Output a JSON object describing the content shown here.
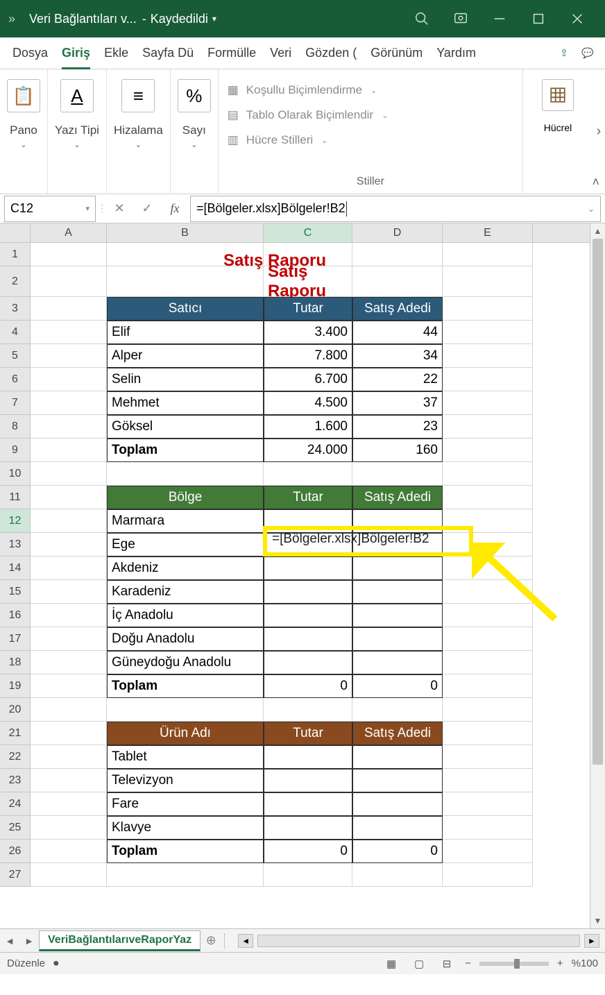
{
  "titlebar": {
    "title": "Veri Bağlantıları v...",
    "saved": "Kaydedildi"
  },
  "tabs": {
    "file": "Dosya",
    "home": "Giriş",
    "insert": "Ekle",
    "page": "Sayfa Dü",
    "formulas": "Formülle",
    "data": "Veri",
    "review": "Gözden (",
    "view": "Görünüm",
    "help": "Yardım"
  },
  "ribbon": {
    "clipboard": "Pano",
    "font": "Yazı Tipi",
    "alignment": "Hizalama",
    "number": "Sayı",
    "cond_format": "Koşullu Biçimlendirme",
    "format_table": "Tablo Olarak Biçimlendir",
    "cell_styles": "Hücre Stilleri",
    "styles_label": "Stiller",
    "cells": "Hücrel"
  },
  "namebox": "C12",
  "formula": "=[Bölgeler.xlsx]Bölgeler!B2",
  "columns": [
    "A",
    "B",
    "C",
    "D",
    "E"
  ],
  "report_title": "Satış Raporu",
  "sales": {
    "headers": [
      "Satıcı",
      "Tutar",
      "Satış Adedi"
    ],
    "rows": [
      {
        "name": "Elif",
        "amount": "3.400",
        "qty": "44"
      },
      {
        "name": "Alper",
        "amount": "7.800",
        "qty": "34"
      },
      {
        "name": "Selin",
        "amount": "6.700",
        "qty": "22"
      },
      {
        "name": "Mehmet",
        "amount": "4.500",
        "qty": "37"
      },
      {
        "name": "Göksel",
        "amount": "1.600",
        "qty": "23"
      }
    ],
    "total_label": "Toplam",
    "total_amount": "24.000",
    "total_qty": "160"
  },
  "regions": {
    "headers": [
      "Bölge",
      "Tutar",
      "Satış Adedi"
    ],
    "rows": [
      "Marmara",
      "Ege",
      "Akdeniz",
      "Karadeniz",
      "İç Anadolu",
      "Doğu Anadolu",
      "Güneydoğu Anadolu"
    ],
    "total_label": "Toplam",
    "total_amount": "0",
    "total_qty": "0"
  },
  "products": {
    "headers": [
      "Ürün Adı",
      "Tutar",
      "Satış Adedi"
    ],
    "rows": [
      "Tablet",
      "Televizyon",
      "Fare",
      "Klavye"
    ],
    "total_label": "Toplam",
    "total_amount": "0",
    "total_qty": "0"
  },
  "cell_formula_display": "=[Bölgeler.xlsx]Bölgeler!B2",
  "sheet_tab": "VeriBağlantılarıveRaporYaz",
  "status": {
    "mode": "Düzenle",
    "zoom": "%100"
  }
}
